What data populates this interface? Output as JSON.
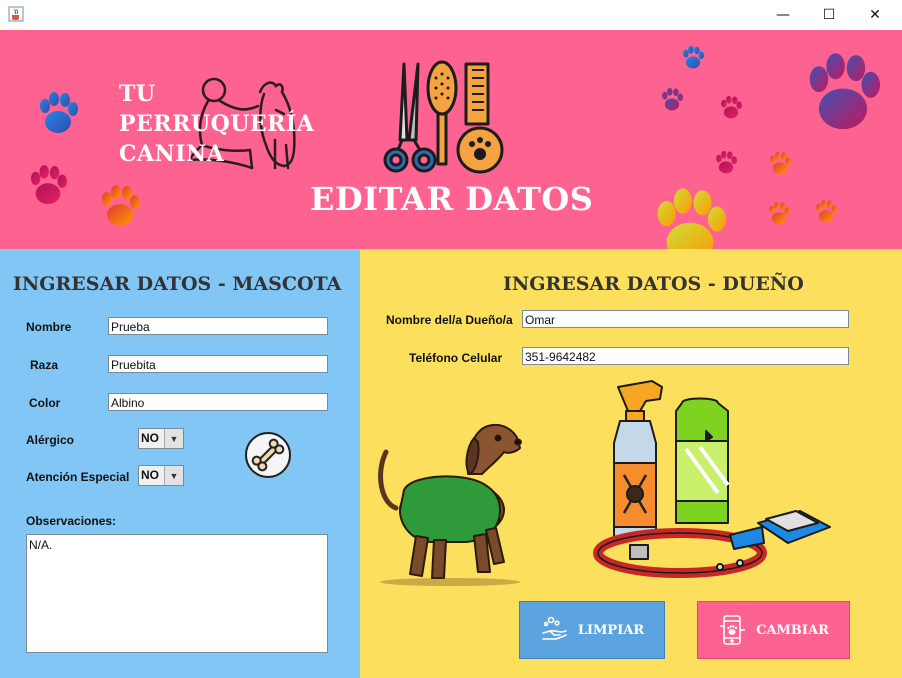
{
  "window": {
    "minimize_glyph": "—",
    "maximize_glyph": "☐",
    "close_glyph": "✕"
  },
  "header": {
    "brand_line1": "TU",
    "brand_line2": "PERRUQUERÍA",
    "brand_line3": "CANINA",
    "title": "EDITAR DATOS"
  },
  "pet_section": {
    "title": "INGRESAR DATOS - MASCOTA",
    "name_label": "Nombre",
    "name_value": "Prueba",
    "breed_label": "Raza",
    "breed_value": "Pruebita",
    "color_label": "Color",
    "color_value": "Albino",
    "allergic_label": "Alérgico",
    "allergic_value": "NO",
    "special_label": "Atención Especial",
    "special_value": "NO",
    "notes_label": "Observaciones:",
    "notes_value": "N/A."
  },
  "owner_section": {
    "title": "INGRESAR DATOS - DUEÑO",
    "owner_label": "Nombre del/a Dueño/a",
    "owner_value": "Omar",
    "phone_label": "Teléfono Celular",
    "phone_value": "351-9642482"
  },
  "buttons": {
    "clear_label": "LIMPIAR",
    "change_label": "CAMBIAR"
  },
  "colors": {
    "header_bg": "#fe6290",
    "left_panel_bg": "#82c6f5",
    "right_panel_bg": "#fcdf5c",
    "clear_button_bg": "#5ba4e0",
    "change_button_bg": "#fe6290"
  },
  "icons": {
    "app": "java-cup-icon",
    "grooming": "grooming-tools-icon",
    "bone": "bone-icon",
    "clear": "soap-hand-icon",
    "change": "phone-paw-icon"
  }
}
